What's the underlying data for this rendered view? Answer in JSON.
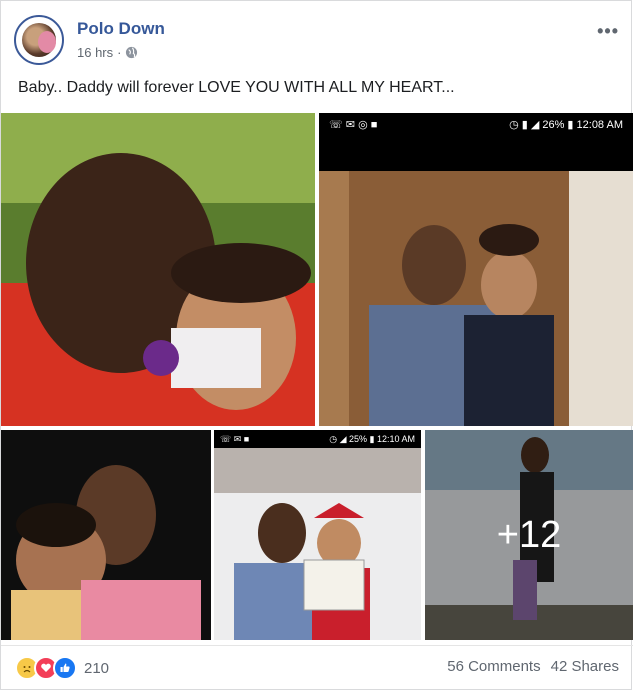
{
  "post": {
    "author": "Polo Down",
    "time": "16 hrs",
    "separator": "·",
    "caption": "Baby.. Daddy will forever LOVE YOU WITH ALL MY HEART...",
    "more": "•••"
  },
  "photos": {
    "p2_status_left": "☏ ✉ ◎ ■",
    "p2_status_right": "◷ ▮ ◢ 26% ▮ 12:08 AM",
    "p4_status_left": "☏ ✉ ■",
    "p4_status_right": "◷ ◢ 25% ▮ 12:10 AM",
    "more_count": "+12"
  },
  "footer": {
    "reaction_count": "210",
    "comments": "56 Comments",
    "shares": "42 Shares"
  }
}
